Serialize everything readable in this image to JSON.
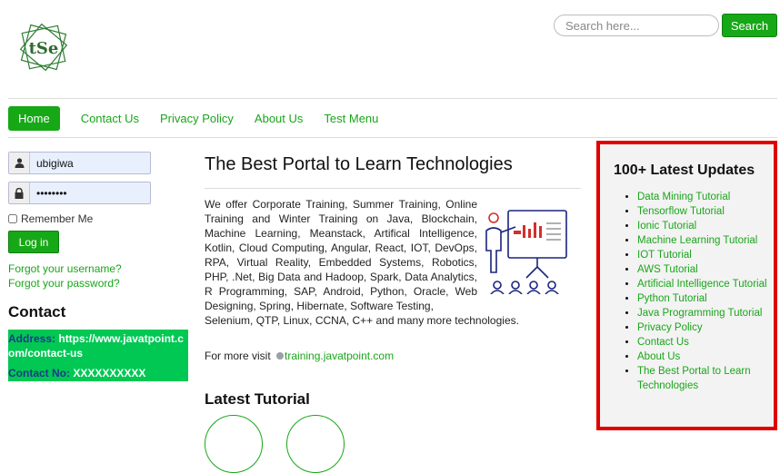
{
  "header": {
    "logo_text": "tSe",
    "search_placeholder": "Search here...",
    "search_button": "Search"
  },
  "nav": {
    "items": [
      "Home",
      "Contact Us",
      "Privacy Policy",
      "About Us",
      "Test Menu"
    ],
    "active": "Home"
  },
  "login": {
    "username_value": "ubigiwa",
    "password_value": "••••••••",
    "remember_label": "Remember Me",
    "login_button": "Log in",
    "forgot_username": "Forgot your username?",
    "forgot_password": "Forgot your password?"
  },
  "contact": {
    "heading": "Contact",
    "address_label": "Address:",
    "address_value": "https://www.javatpoint.com/contact-us",
    "number_label": "Contact No:",
    "number_value": "XXXXXXXXXX"
  },
  "main": {
    "title": "The Best Portal to Learn Technologies",
    "intro": "We offer Corporate Training, Summer Training, Online Training and Winter Training on Java, Blockchain, Machine Learning, Meanstack, Artifical Intelligence, Kotlin, Cloud Computing, Angular, React, IOT, DevOps, RPA, Virtual Reality, Embedded Systems, Robotics, PHP, .Net, Big Data and Hadoop, Spark, Data Analytics, R Programming, SAP, Android, Python, Oracle, Web Designing, Spring, Hibernate, Software Testing,",
    "intro_tail": "Selenium, QTP, Linux, CCNA, C++ and many more technologies.",
    "visit_prefix": "For more visit",
    "visit_link": "training.javatpoint.com",
    "latest_tutorial_heading": "Latest Tutorial"
  },
  "updates": {
    "heading": "100+ Latest Updates",
    "items": [
      "Data Mining Tutorial",
      "Tensorflow Tutorial",
      "Ionic Tutorial",
      "Machine Learning Tutorial",
      "IOT Tutorial",
      "AWS Tutorial",
      "Artificial Intelligence Tutorial",
      "Python Tutorial",
      "Java Programming Tutorial",
      "Privacy Policy",
      "Contact Us",
      "About Us",
      "The Best Portal to Learn Technologies"
    ]
  },
  "colors": {
    "accent_green": "#17a817",
    "link_green": "#1aa51a",
    "highlight_red": "#e00000",
    "contact_box": "#00c853"
  }
}
